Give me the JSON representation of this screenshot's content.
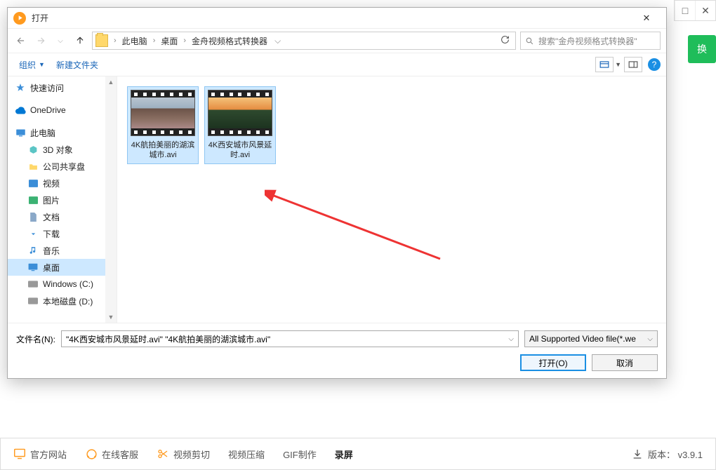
{
  "bg": {
    "convert_btn": "换",
    "win_max": "□",
    "win_close": "✕"
  },
  "dialog": {
    "title": "打开",
    "breadcrumb": {
      "root": "此电脑",
      "p1": "桌面",
      "p2": "金舟视频格式转换器"
    },
    "search_placeholder": "搜索\"金舟视频格式转换器\"",
    "toolbar": {
      "organize": "组织",
      "new_folder": "新建文件夹"
    },
    "tree": {
      "quick": "快速访问",
      "onedrive": "OneDrive",
      "this_pc": "此电脑",
      "items": [
        "3D 对象",
        "公司共享盘",
        "视频",
        "图片",
        "文档",
        "下载",
        "音乐",
        "桌面",
        "Windows (C:)",
        "本地磁盘 (D:)"
      ]
    },
    "files": [
      {
        "name": "4K航拍美丽的湖滨城市.avi"
      },
      {
        "name": "4K西安城市风景延时.avi"
      }
    ],
    "filename_label": "文件名(N):",
    "filename_value": "\"4K西安城市风景延时.avi\" \"4K航拍美丽的湖滨城市.avi\"",
    "filter": "All Supported Video file(*.we",
    "open_btn": "打开(O)",
    "cancel_btn": "取消"
  },
  "footer": {
    "site": "官方网站",
    "support": "在线客服",
    "cut": "视频剪切",
    "compress": "视频压缩",
    "gif": "GIF制作",
    "record": "录屏",
    "version": "版本： v3.9.1"
  }
}
